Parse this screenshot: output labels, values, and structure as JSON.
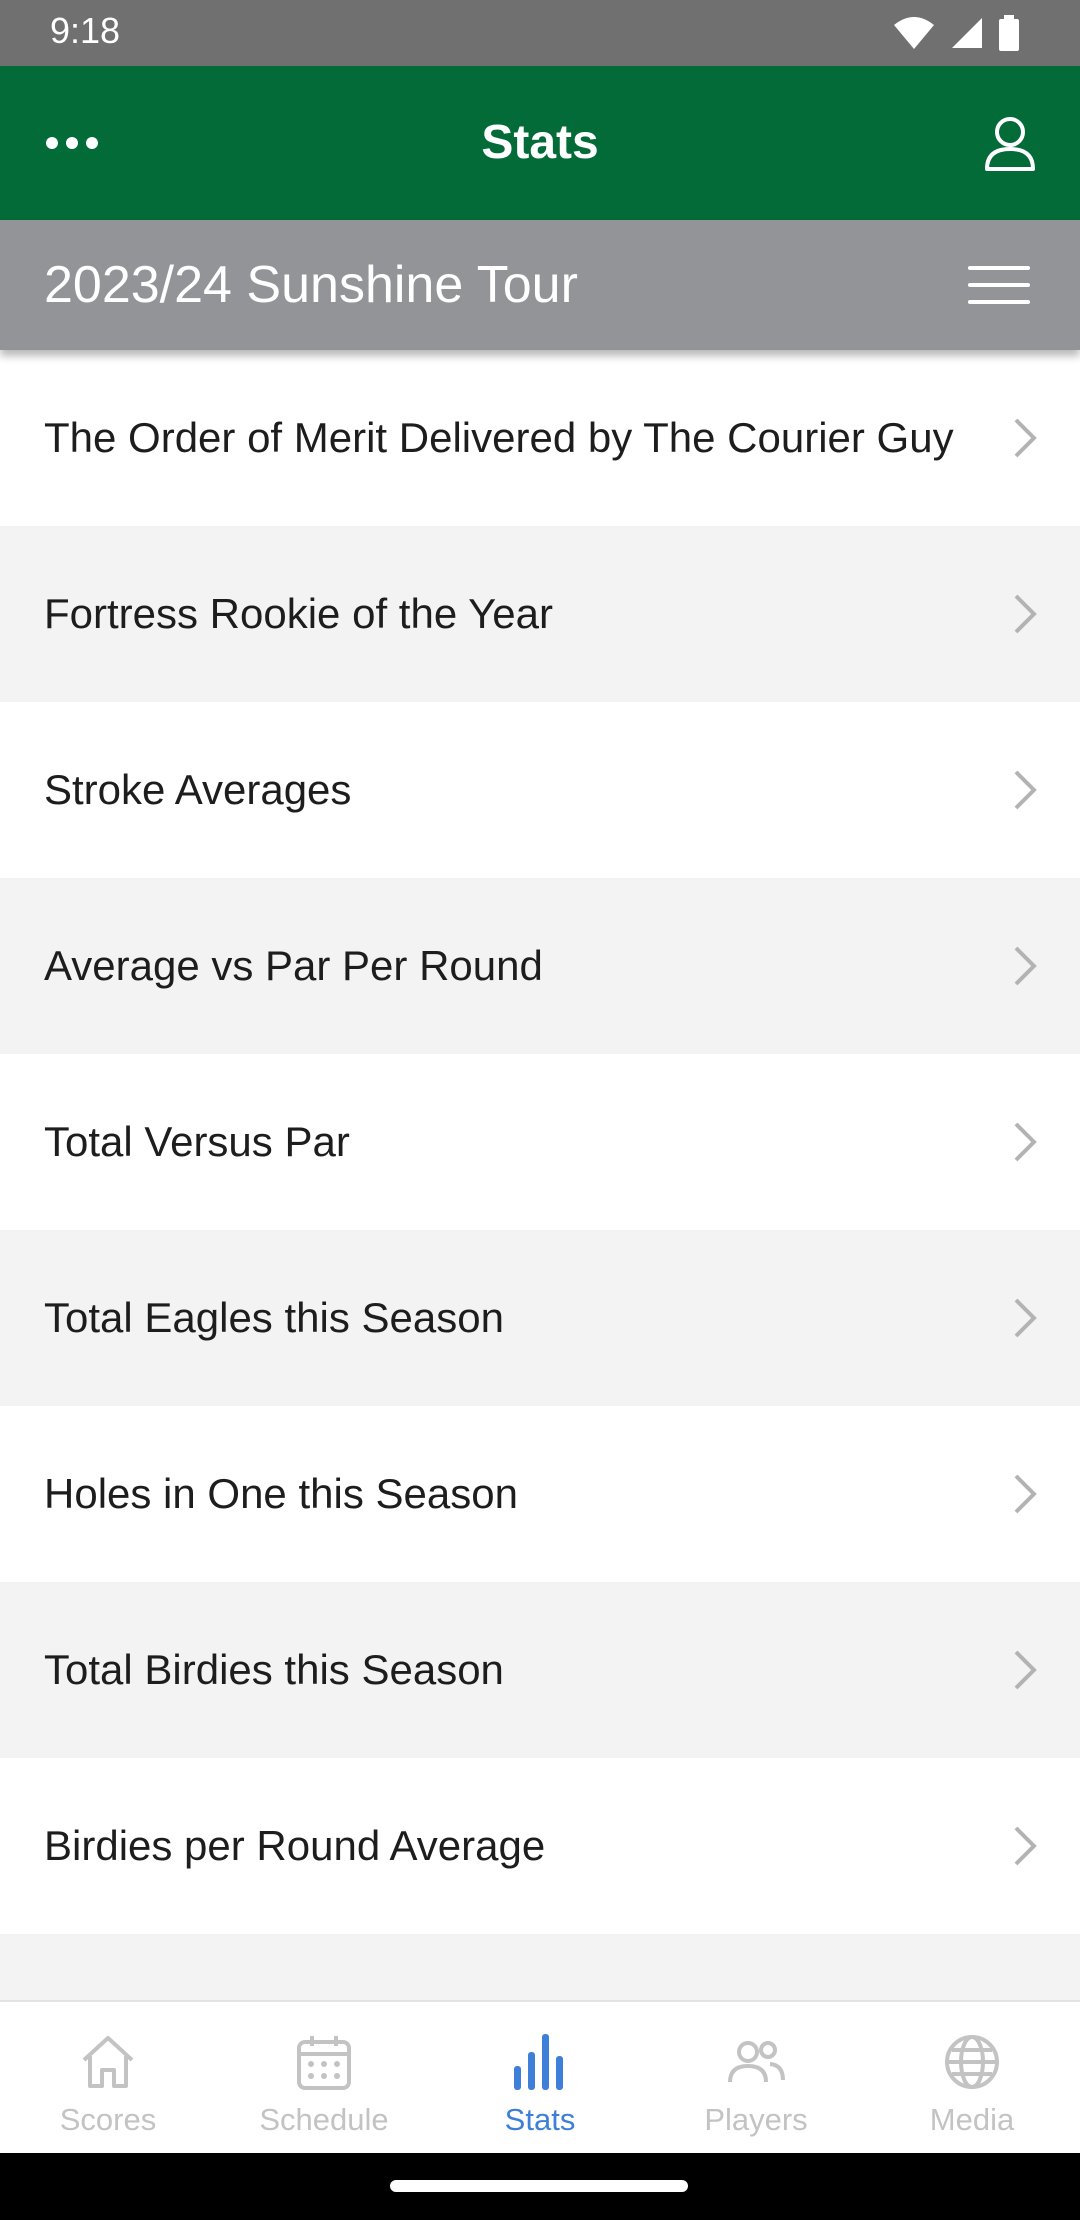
{
  "status_bar": {
    "time": "9:18",
    "icons": [
      "wifi-icon",
      "cellular-signal-icon",
      "battery-icon"
    ]
  },
  "app_bar": {
    "title": "Stats",
    "left_icon": "more-horizontal-icon",
    "right_icon": "profile-icon",
    "background": "#026b37"
  },
  "season": {
    "title": "2023/24 Sunshine Tour",
    "menu_icon": "hamburger-menu-icon"
  },
  "stats_list": [
    {
      "label": "The Order of Merit Delivered by The Courier Guy"
    },
    {
      "label": "Fortress Rookie of the Year"
    },
    {
      "label": "Stroke Averages"
    },
    {
      "label": "Average vs Par Per Round"
    },
    {
      "label": "Total Versus Par"
    },
    {
      "label": "Total Eagles this Season"
    },
    {
      "label": "Holes in One this Season"
    },
    {
      "label": "Total Birdies this Season"
    },
    {
      "label": "Birdies per Round Average"
    },
    {
      "label": ""
    }
  ],
  "tabs": [
    {
      "label": "Scores",
      "icon": "home-icon",
      "active": false
    },
    {
      "label": "Schedule",
      "icon": "calendar-icon",
      "active": false
    },
    {
      "label": "Stats",
      "icon": "bar-chart-icon",
      "active": true
    },
    {
      "label": "Players",
      "icon": "players-icon",
      "active": false
    },
    {
      "label": "Media",
      "icon": "globe-icon",
      "active": false
    }
  ],
  "colors": {
    "active_tab": "#3e7fd9",
    "inactive_tab": "#c3c3c3",
    "season_bar": "#929498"
  }
}
